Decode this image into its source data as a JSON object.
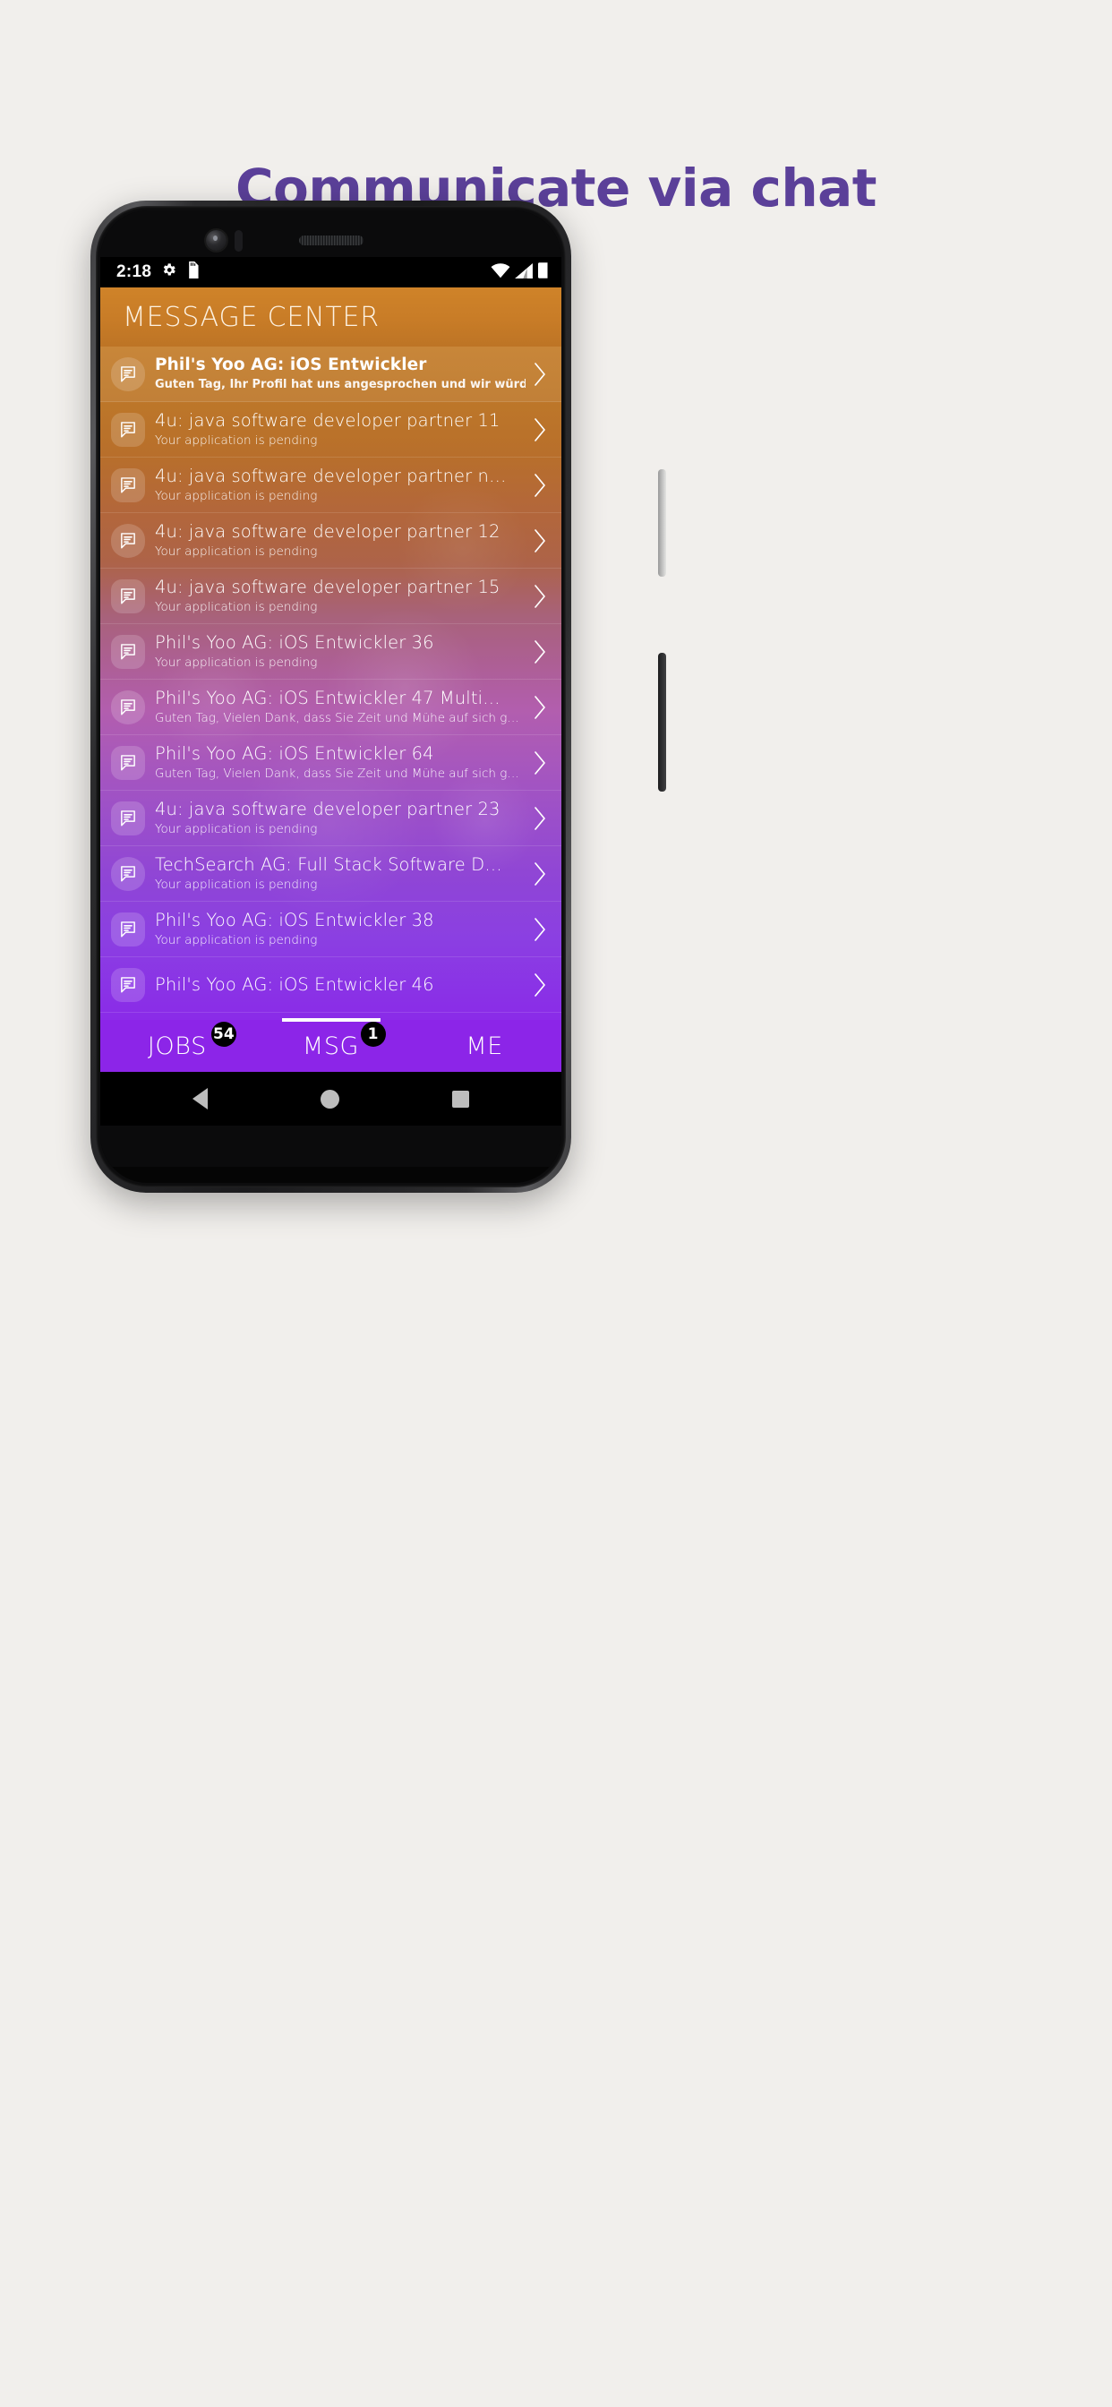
{
  "headline": "Communicate via chat",
  "theme": {
    "headline_color": "#5b4099",
    "page_background": "#f1efec",
    "header_orange": "#c87c27",
    "tabbar_purple": "#8c25e8",
    "gradient_start": "#c47d2a",
    "gradient_end": "#8a2be8"
  },
  "statusbar": {
    "time": "2:18",
    "icons_left": [
      "gear-icon",
      "sd-card-icon"
    ],
    "icons_right": [
      "wifi-icon",
      "cellular-signal-icon",
      "battery-icon"
    ]
  },
  "app": {
    "title": "MESSAGE CENTER"
  },
  "messages": [
    {
      "title": "Phil's Yoo AG: iOS Entwickler",
      "subtitle": "Guten Tag, Ihr Profil hat uns angesprochen und wir würd…",
      "unread": true,
      "icon": "chat-bubble-icon"
    },
    {
      "title": "4u: java software developer partner 11",
      "subtitle": "Your application is pending",
      "unread": false,
      "icon": "chat-bubble-icon"
    },
    {
      "title": "4u: java software developer partner n…",
      "subtitle": "Your application is pending",
      "unread": false,
      "icon": "chat-bubble-icon"
    },
    {
      "title": "4u: java software developer partner 12",
      "subtitle": "Your application is pending",
      "unread": false,
      "icon": "chat-bubble-icon"
    },
    {
      "title": "4u: java software developer partner 15",
      "subtitle": "Your application is pending",
      "unread": false,
      "icon": "chat-bubble-icon"
    },
    {
      "title": "Phil's Yoo AG: iOS Entwickler 36",
      "subtitle": "Your application is pending",
      "unread": false,
      "icon": "chat-bubble-icon"
    },
    {
      "title": "Phil's Yoo AG: iOS Entwickler 47 Multi…",
      "subtitle": "Guten Tag, Vielen Dank, dass Sie Zeit und Mühe auf sich g…",
      "unread": false,
      "icon": "chat-bubble-icon"
    },
    {
      "title": "Phil's Yoo AG: iOS Entwickler 64",
      "subtitle": "Guten Tag, Vielen Dank, dass Sie Zeit und Mühe auf sich g…",
      "unread": false,
      "icon": "chat-bubble-icon"
    },
    {
      "title": "4u: java software developer partner 23",
      "subtitle": "Your application is pending",
      "unread": false,
      "icon": "chat-bubble-icon"
    },
    {
      "title": "TechSearch AG: Full Stack Software D…",
      "subtitle": "Your application is pending",
      "unread": false,
      "icon": "chat-bubble-icon"
    },
    {
      "title": "Phil's Yoo AG: iOS Entwickler 38",
      "subtitle": "Your application is pending",
      "unread": false,
      "icon": "chat-bubble-icon"
    },
    {
      "title": "Phil's Yoo AG: iOS Entwickler 46",
      "subtitle": "",
      "unread": false,
      "icon": "chat-bubble-icon"
    }
  ],
  "tabs": [
    {
      "label": "JOBS",
      "badge": "54",
      "active": false
    },
    {
      "label": "MSG",
      "badge": "1",
      "active": true
    },
    {
      "label": "ME",
      "badge": "",
      "active": false
    }
  ],
  "navbar": {
    "back": "back-triangle-icon",
    "home": "home-circle-icon",
    "recents": "recents-square-icon"
  }
}
